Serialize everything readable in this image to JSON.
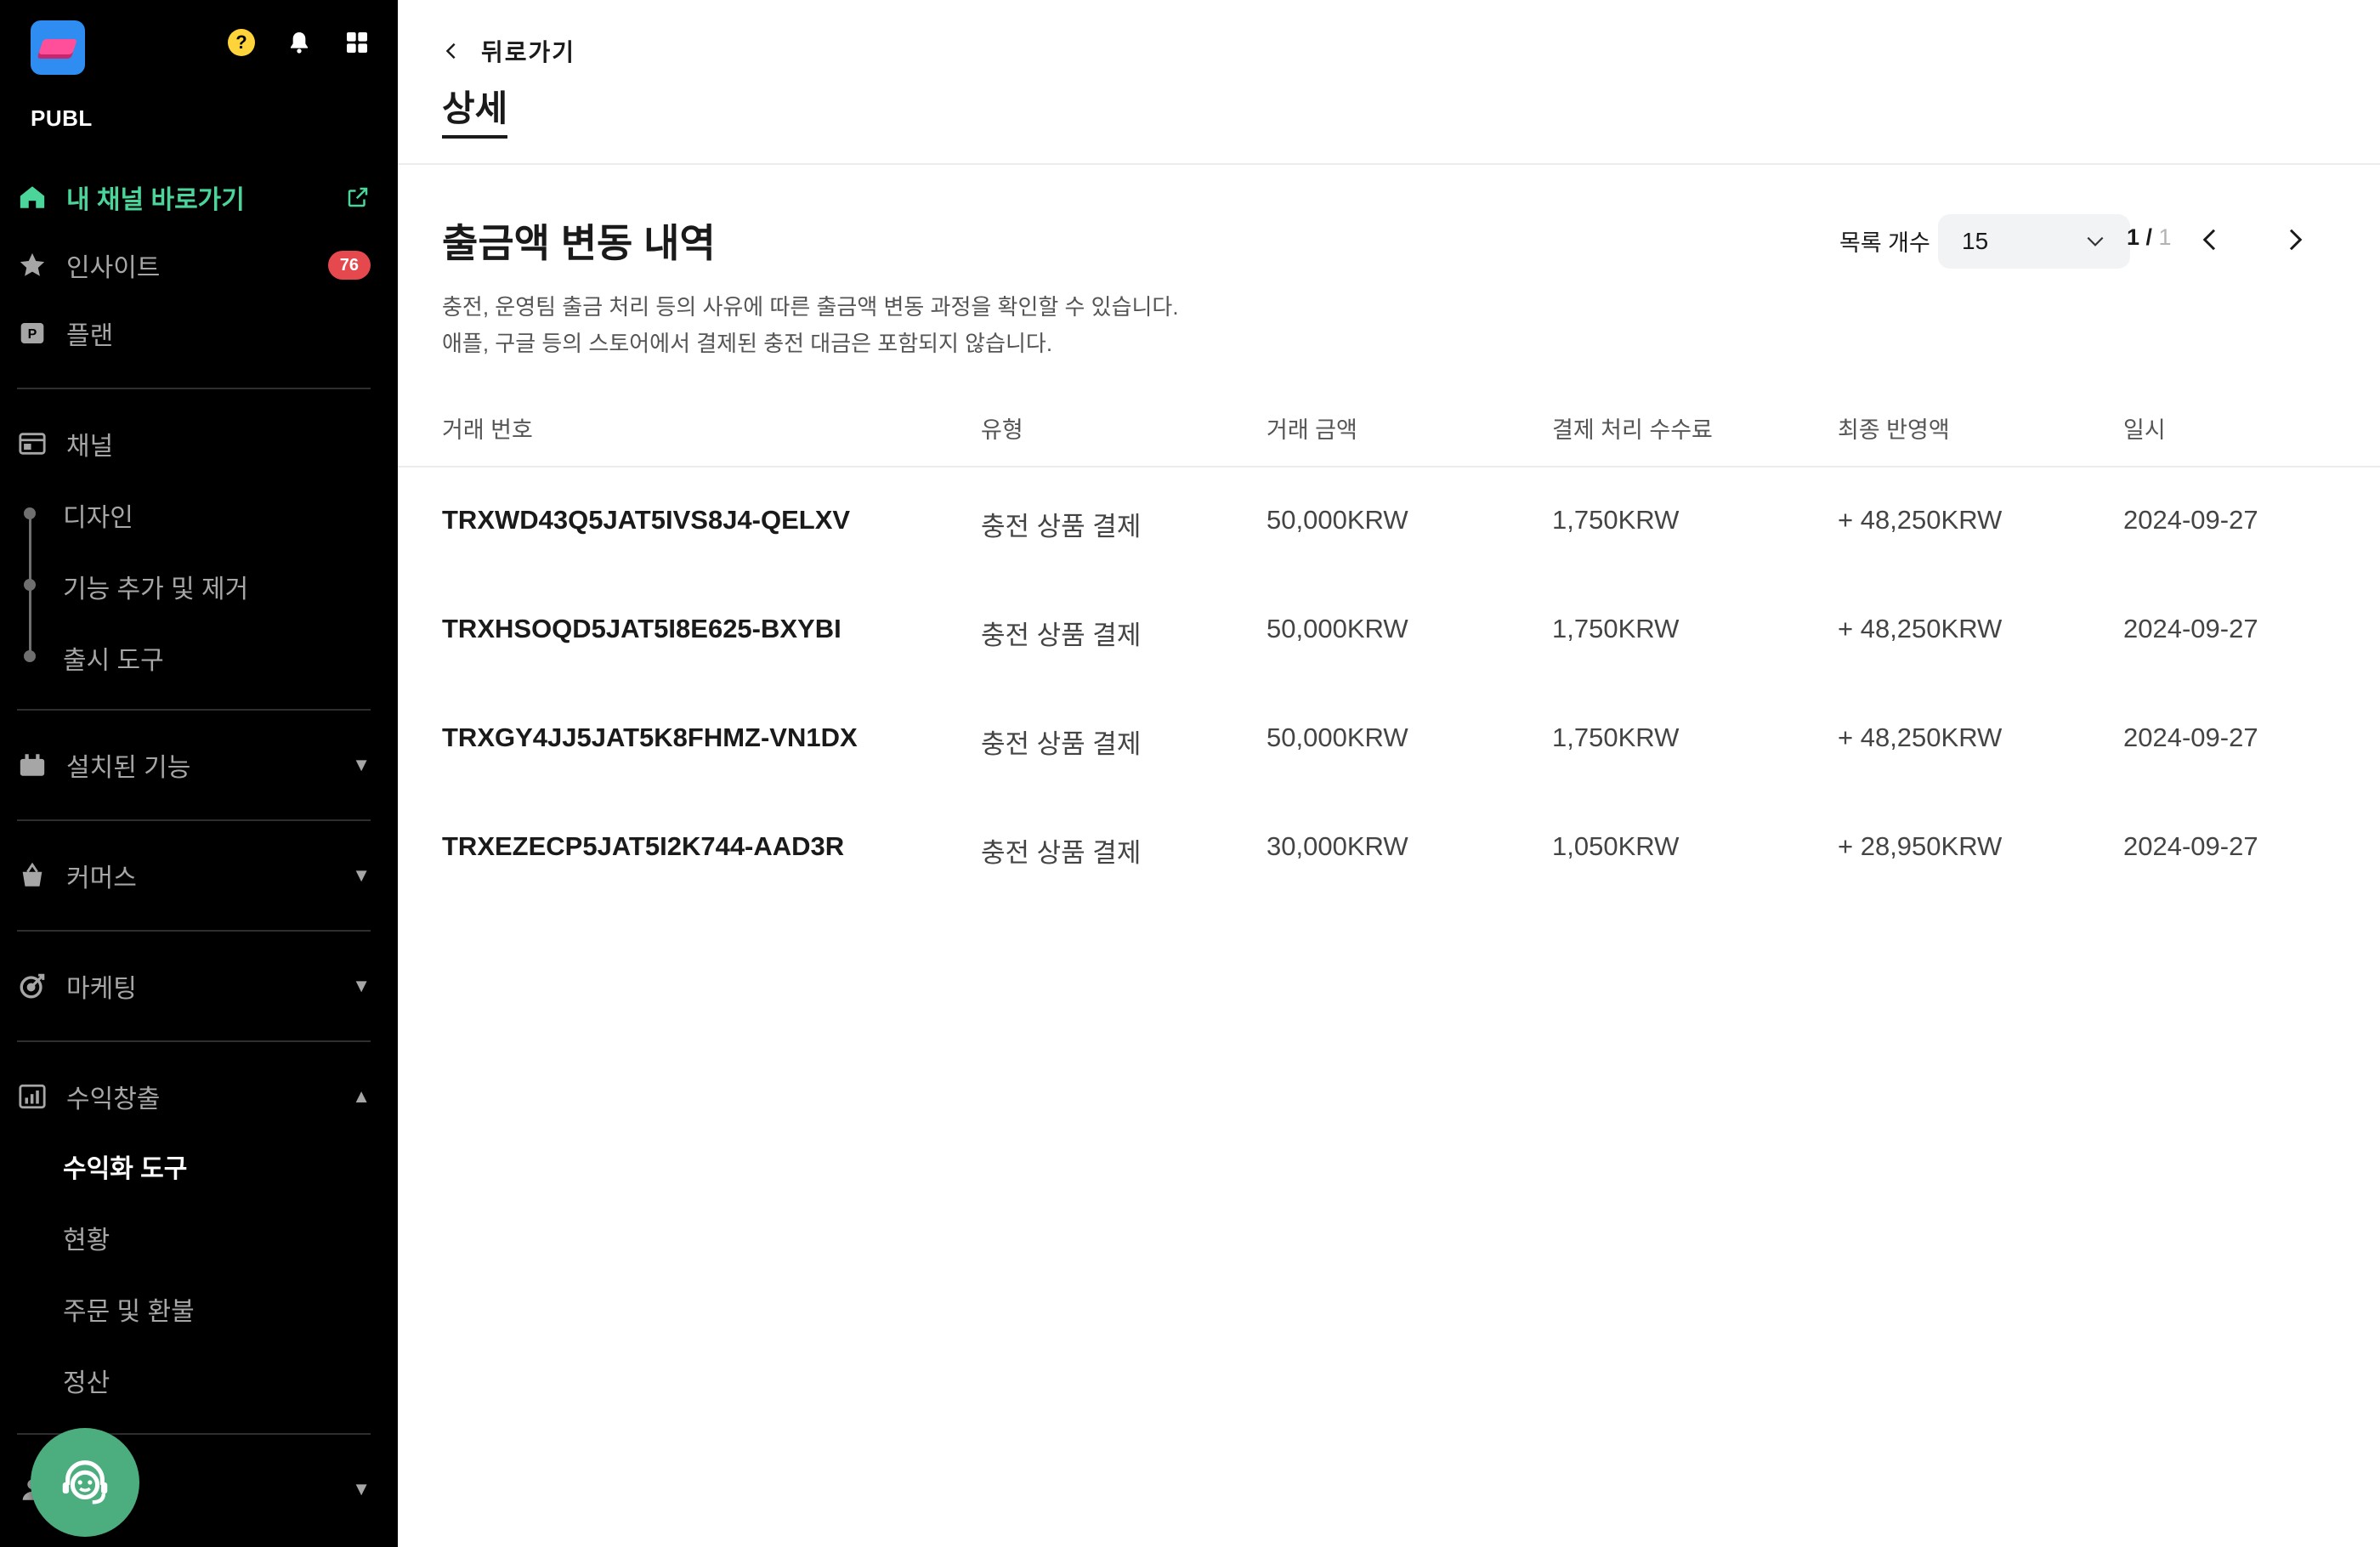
{
  "sidebar": {
    "brand": "PUBL",
    "items": [
      {
        "label": "내 채널 바로가기"
      },
      {
        "label": "인사이트",
        "badge": "76"
      },
      {
        "label": "플랜"
      },
      {
        "label": "채널"
      },
      {
        "label": "설치된 기능"
      },
      {
        "label": "커머스"
      },
      {
        "label": "마케팅"
      },
      {
        "label": "수익창출"
      }
    ],
    "channel_sub": [
      "디자인",
      "기능 추가 및 제거",
      "출시 도구"
    ],
    "revenue_sub": [
      "수익화 도구",
      "현황",
      "주문 및 환불",
      "정산"
    ],
    "colors": {
      "active": "#4bd59a",
      "badge": "#e5484d",
      "support": "#4cae7e"
    }
  },
  "header": {
    "back_label": "뒤로가기",
    "page_title": "상세"
  },
  "main": {
    "section_title": "출금액 변동 내역",
    "description_line1": "충전, 운영팀 출금 처리 등의 사유에 따른 출금액 변동 과정을 확인할 수 있습니다.",
    "description_line2": "애플, 구글 등의 스토어에서 결제된 충전 대금은 포함되지 않습니다.",
    "list_count_label": "목록 개수",
    "list_count_value": "15",
    "pager_current": "1",
    "pager_sep": " / ",
    "pager_total": "1"
  },
  "table": {
    "headers": [
      "거래 번호",
      "유형",
      "거래 금액",
      "결제 처리 수수료",
      "최종 반영액",
      "일시"
    ],
    "rows": [
      {
        "id": "TRXWD43Q5JAT5IVS8J4-QELXV",
        "type": "충전 상품 결제",
        "amount": "50,000KRW",
        "fee": "1,750KRW",
        "final": "+ 48,250KRW",
        "date": "2024-09-27"
      },
      {
        "id": "TRXHSOQD5JAT5I8E625-BXYBI",
        "type": "충전 상품 결제",
        "amount": "50,000KRW",
        "fee": "1,750KRW",
        "final": "+ 48,250KRW",
        "date": "2024-09-27"
      },
      {
        "id": "TRXGY4JJ5JAT5K8FHMZ-VN1DX",
        "type": "충전 상품 결제",
        "amount": "50,000KRW",
        "fee": "1,750KRW",
        "final": "+ 48,250KRW",
        "date": "2024-09-27"
      },
      {
        "id": "TRXEZECP5JAT5I2K744-AAD3R",
        "type": "충전 상품 결제",
        "amount": "30,000KRW",
        "fee": "1,050KRW",
        "final": "+ 28,950KRW",
        "date": "2024-09-27"
      }
    ]
  }
}
